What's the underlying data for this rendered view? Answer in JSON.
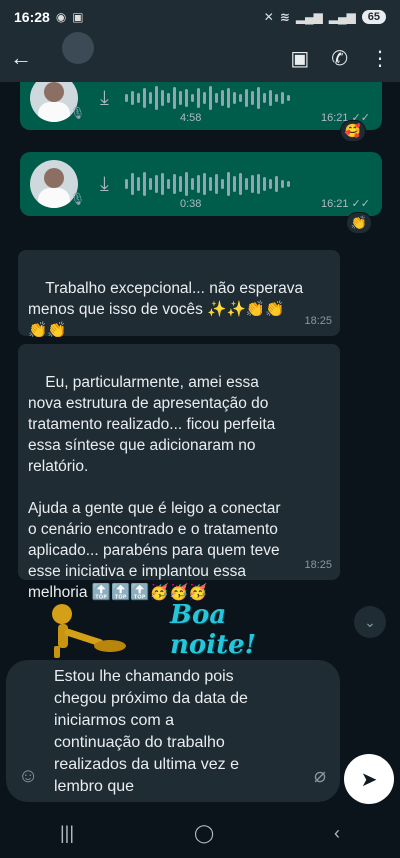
{
  "status_bar": {
    "time": "16:28",
    "battery": "65"
  },
  "app_bar": {
    "back_icon": "arrow-left-icon",
    "actions": [
      "contact-card-icon",
      "add-call-icon",
      "more-vert-icon"
    ]
  },
  "messages": [
    {
      "type": "voice_out",
      "duration": "4:58",
      "time": "16:21",
      "reaction": "🥰"
    },
    {
      "type": "voice_out",
      "duration": "0:38",
      "time": "16:21",
      "reaction": "👏"
    },
    {
      "type": "text_in",
      "text": "Trabalho excepcional... não esperava\nmenos que isso de vocês ✨✨👏👏\n👏👏",
      "time": "18:25"
    },
    {
      "type": "text_in",
      "text": "Eu, particularmente, amei essa\nnova estrutura de apresentação do\ntratamento realizado... ficou perfeita\nessa síntese que adicionaram no\nrelatório.\n\nAjuda a gente que é leigo a conectar\no cenário encontrado e o tratamento\naplicado... parabéns para quem teve\nesse iniciativa e implantou essa\nmelhoria 🔝🔝🔝🥳🥳🥳",
      "time": "18:25"
    },
    {
      "type": "sticker_in",
      "text": "Boa noite!"
    }
  ],
  "compose": {
    "text": "Estou lhe chamando pois\nchegou próximo da data de\niniciarmos com a\ncontinuação do trabalho\nrealizados da ultima vez e\nlembro que"
  },
  "colors": {
    "background": "#0b141a",
    "incoming_bubble": "#1f2c34",
    "outgoing_bubble": "#005c4b"
  }
}
